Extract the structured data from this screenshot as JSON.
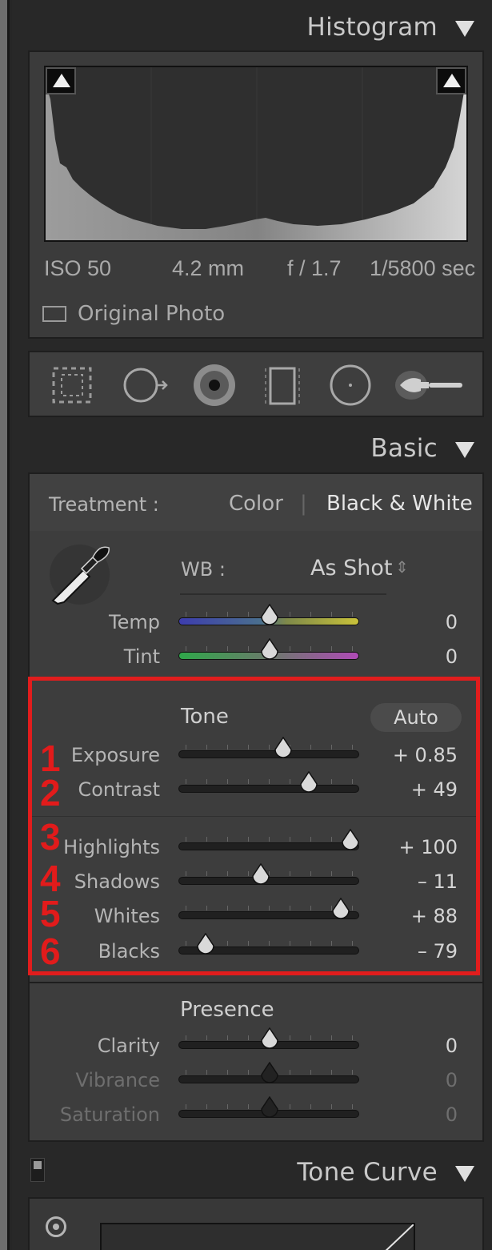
{
  "histogram": {
    "title": "Histogram",
    "exif": {
      "iso": "ISO 50",
      "focal": "4.2 mm",
      "aperture": "f / 1.7",
      "shutter": "1/5800 sec"
    },
    "original_photo_label": "Original Photo"
  },
  "tools": [
    "crop-overlay-icon",
    "spot-removal-icon",
    "red-eye-icon",
    "graduated-filter-icon",
    "radial-filter-icon",
    "adjustment-brush-icon"
  ],
  "basic": {
    "title": "Basic",
    "treatment_label": "Treatment :",
    "treatment_color": "Color",
    "treatment_separator": "|",
    "treatment_bw": "Black & White",
    "wb_label": "WB :",
    "wb_value": "As Shot",
    "wb_arrows": "⇕",
    "temp": {
      "label": "Temp",
      "value": "0",
      "position": 0.5
    },
    "tint": {
      "label": "Tint",
      "value": "0",
      "position": 0.5
    },
    "tone_label": "Tone",
    "auto_label": "Auto",
    "tone_sliders": [
      {
        "num": "1",
        "label": "Exposure",
        "value": "+ 0.85",
        "position": 0.585
      },
      {
        "num": "2",
        "label": "Contrast",
        "value": "+ 49",
        "position": 0.745
      },
      {
        "num": "3",
        "label": "Highlights",
        "value": "+ 100",
        "position": 1.0
      },
      {
        "num": "4",
        "label": "Shadows",
        "value": "– 11",
        "position": 0.445
      },
      {
        "num": "5",
        "label": "Whites",
        "value": "+ 88",
        "position": 0.94
      },
      {
        "num": "6",
        "label": "Blacks",
        "value": "– 79",
        "position": 0.105
      }
    ],
    "presence_label": "Presence",
    "presence_sliders": [
      {
        "label": "Clarity",
        "value": "0",
        "position": 0.5,
        "dim": false
      },
      {
        "label": "Vibrance",
        "value": "0",
        "position": 0.5,
        "dim": true
      },
      {
        "label": "Saturation",
        "value": "0",
        "position": 0.5,
        "dim": true
      }
    ]
  },
  "tone_curve": {
    "title": "Tone Curve"
  },
  "colors": {
    "highlight_box": "#e11d1d",
    "panel_bg": "#3d3d3d"
  }
}
